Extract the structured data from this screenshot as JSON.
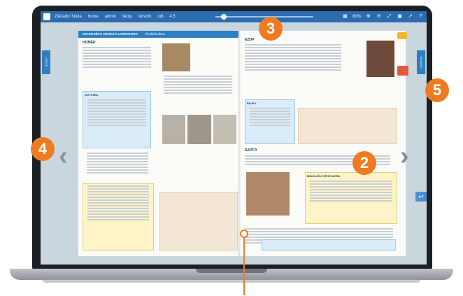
{
  "toolbar": {
    "items": [
      "Základní škola",
      "home",
      "admin",
      "školy",
      "slovník",
      "odl",
      "4.5"
    ],
    "zoom": "80%",
    "icons": [
      "search-icon",
      "zoom-out-icon",
      "fullscreen-icon",
      "print-icon",
      "share-icon",
      "help-icon"
    ]
  },
  "left_page": {
    "band_title": "STAROVĚKÁ ANTICKÁ LITERATURA",
    "band_subtitle": "Řecká kultura",
    "section_title": "HOMÉR",
    "side_tab": "VERZE",
    "info_box_title": "ODYSSEA"
  },
  "right_page": {
    "section_title": "EZOP",
    "section_title_2": "SAPFÓ",
    "side_tab": "BONUSY",
    "box_label": "BÁJKY",
    "box_label_2": "MIKULÁŠ A SPISOVATEL"
  },
  "callouts": {
    "c2": "2",
    "c3": "3",
    "c4": "4",
    "c5": "5"
  }
}
